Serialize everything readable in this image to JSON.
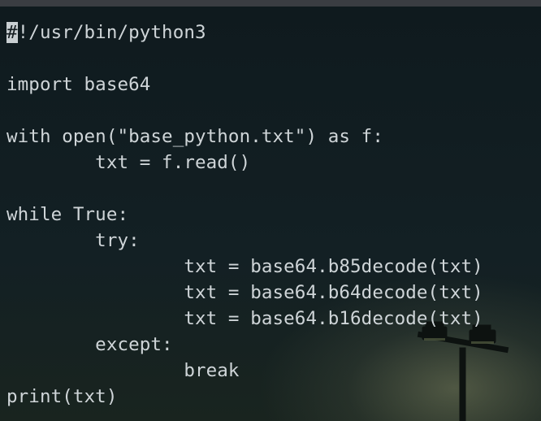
{
  "editor": {
    "cursor_char": "#",
    "lines": [
      "!/usr/bin/python3",
      "",
      "import base64",
      "",
      "with open(\"base_python.txt\") as f:",
      "        txt = f.read()",
      "",
      "while True:",
      "        try:",
      "                txt = base64.b85decode(txt)",
      "                txt = base64.b64decode(txt)",
      "                txt = base64.b16decode(txt)",
      "        except:",
      "                break",
      "print(txt)"
    ]
  },
  "colors": {
    "background": "#141c20",
    "text": "#cfd5d8",
    "cursor": "#c9cfd2",
    "titlebar": "#3a3d42"
  }
}
